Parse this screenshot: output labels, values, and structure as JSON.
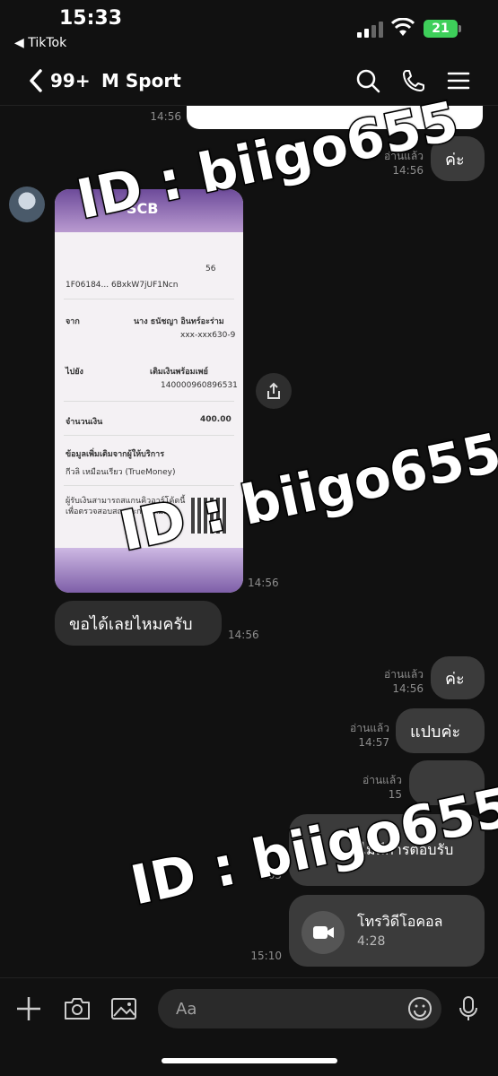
{
  "status_bar": {
    "time": "15:33",
    "back_app": "◀ TikTok",
    "battery": "21"
  },
  "header": {
    "unread_count": "99+",
    "chat_name": "M Sport"
  },
  "messages": {
    "top_time": "14:56",
    "read1": "อ่านแล้ว",
    "time1": "14:56",
    "text1": "ค่ะ",
    "image_time": "14:56",
    "text2": "ขอได้เลยไหมครับ",
    "time2": "14:56",
    "read3": "อ่านแล้ว",
    "time3": "14:56",
    "text3": "ค่ะ",
    "read4": "อ่านแล้ว",
    "time4": "14:57",
    "text4": "แปบค่ะ",
    "read5": "อ่านแล้ว",
    "time5": "15",
    "missed_call_label": "ไม่มีการตอบรับ",
    "missed_call_time": "05",
    "video_call_label": "โทรวิดีโอคอล",
    "video_call_duration": "4:28",
    "video_call_time": "15:10"
  },
  "slip": {
    "bank": "SCB",
    "ref_time": "56",
    "ref_code": "1F06184... 6BxkW7jUF1Ncn",
    "from_label": "จาก",
    "from_name": "นาง ธนัชญา อินทร์อะร่าม",
    "from_account": "xxx-xxx630-9",
    "to_label": "ไปยัง",
    "to_name": "เติมเงินพร้อมเพย์",
    "to_account": "140000960896531",
    "amount_label": "จำนวนเงิน",
    "amount": "400.00",
    "extra_label": "ข้อมูลเพิ่มเติมจากผู้ให้บริการ",
    "extra_value": "กีวลิ เหมือนเรียว (TrueMoney)",
    "qr_note": "ผู้รับเงินสามารถสแกนคิวอาร์โค้ดนี้เพื่อตรวจสอบสถานะการเติมเงิน"
  },
  "watermarks": [
    "ID : biigo655",
    "ID : biigo655",
    "ID : biigo655"
  ],
  "input": {
    "placeholder": "Aa"
  },
  "colors": {
    "background": "#111111",
    "bubble": "#3b3b3b",
    "battery": "#3ecf5a"
  }
}
